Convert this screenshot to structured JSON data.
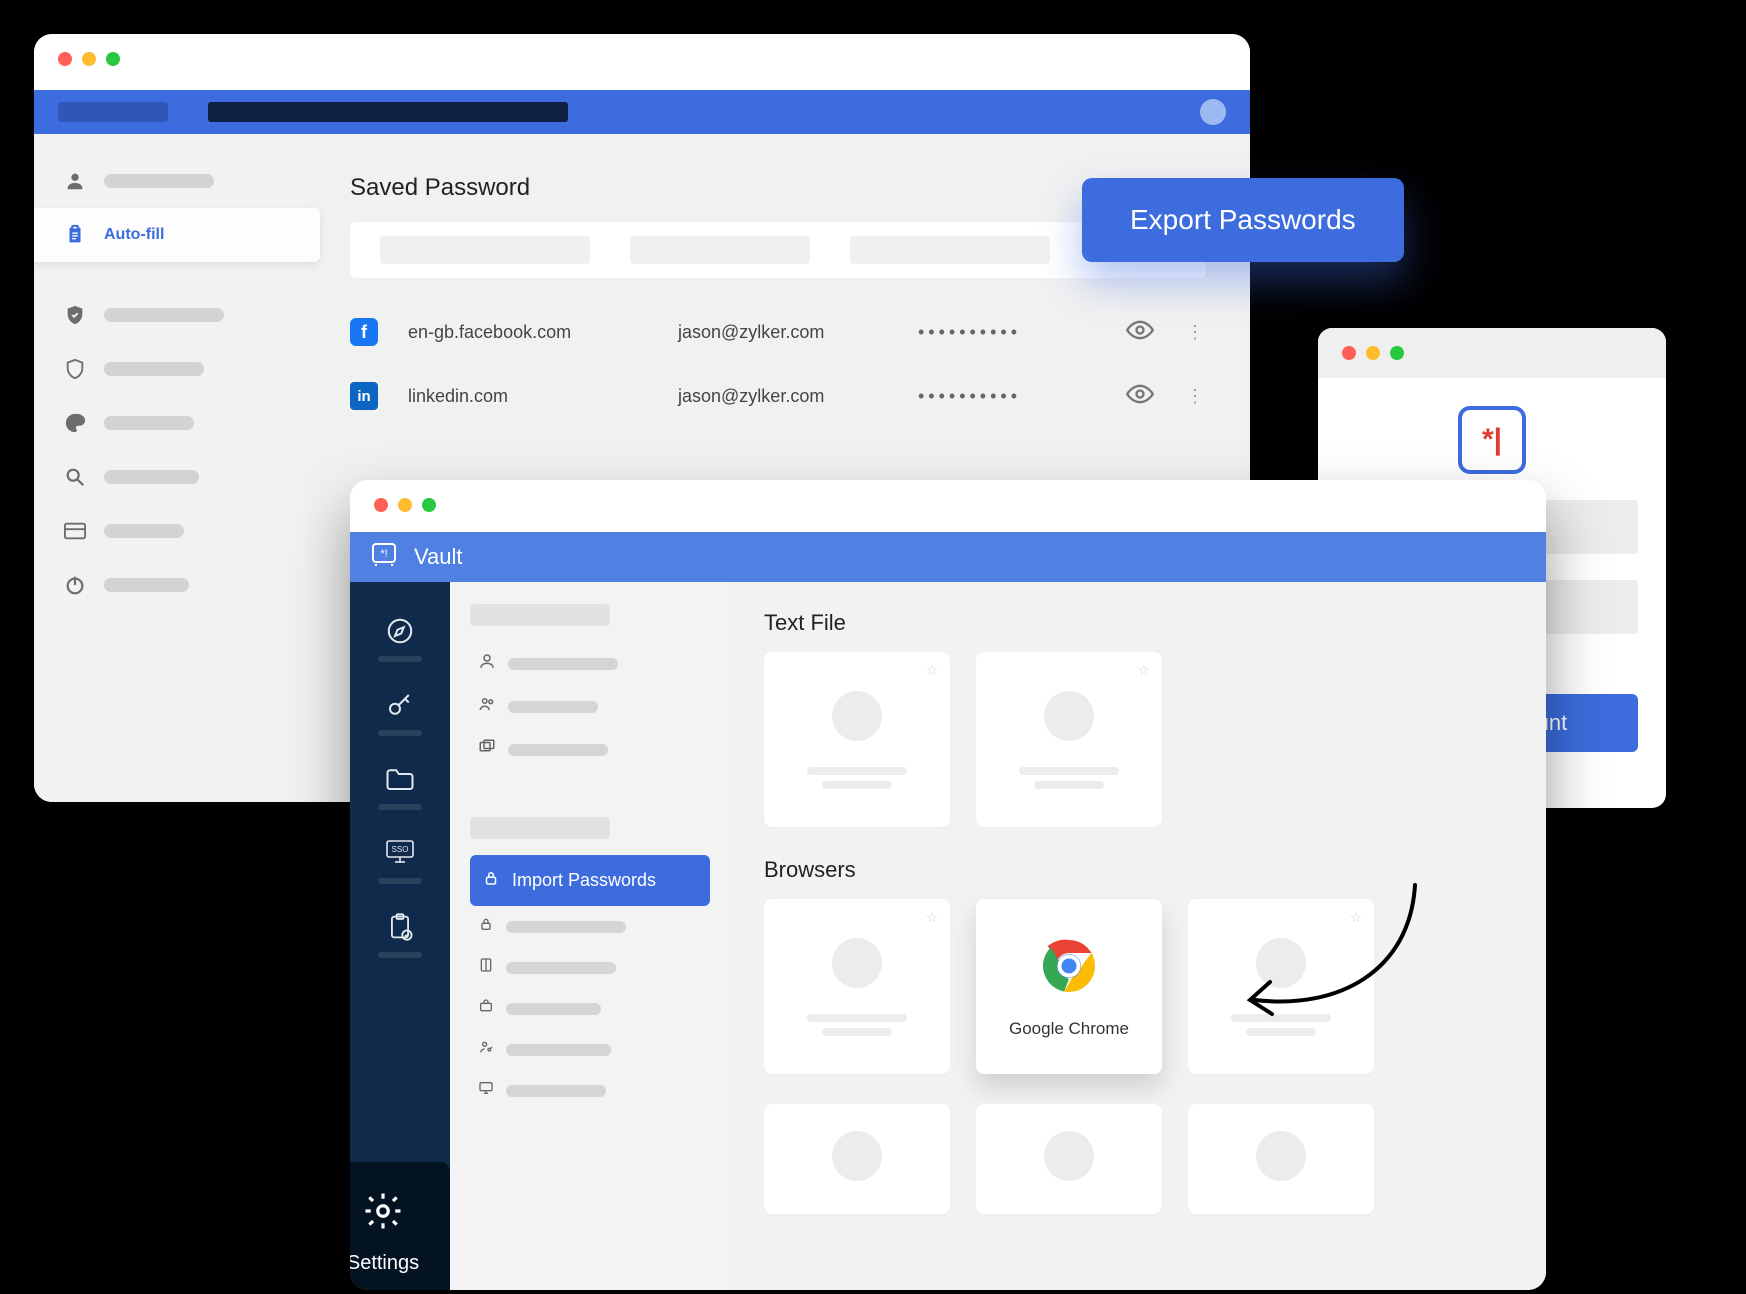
{
  "chrome_window": {
    "sidebar": {
      "autofill_label": "Auto-fill"
    },
    "section_title": "Saved Password",
    "passwords": [
      {
        "brand": "fb",
        "site": "en-gb.facebook.com",
        "user": "jason@zylker.com",
        "masked": "••••••••••"
      },
      {
        "brand": "li",
        "site": "linkedin.com",
        "user": "jason@zylker.com",
        "masked": "••••••••••"
      }
    ]
  },
  "export_button": "Export Passwords",
  "popup": {
    "logo_text": "*|",
    "create_button": "Create Account"
  },
  "vault_window": {
    "title": "Vault",
    "midnav": {
      "active_label": "Import Passwords"
    },
    "settings_label": "Settings",
    "sections": {
      "text_file": "Text File",
      "browsers": "Browsers"
    },
    "chrome_card_label": "Google Chrome"
  }
}
